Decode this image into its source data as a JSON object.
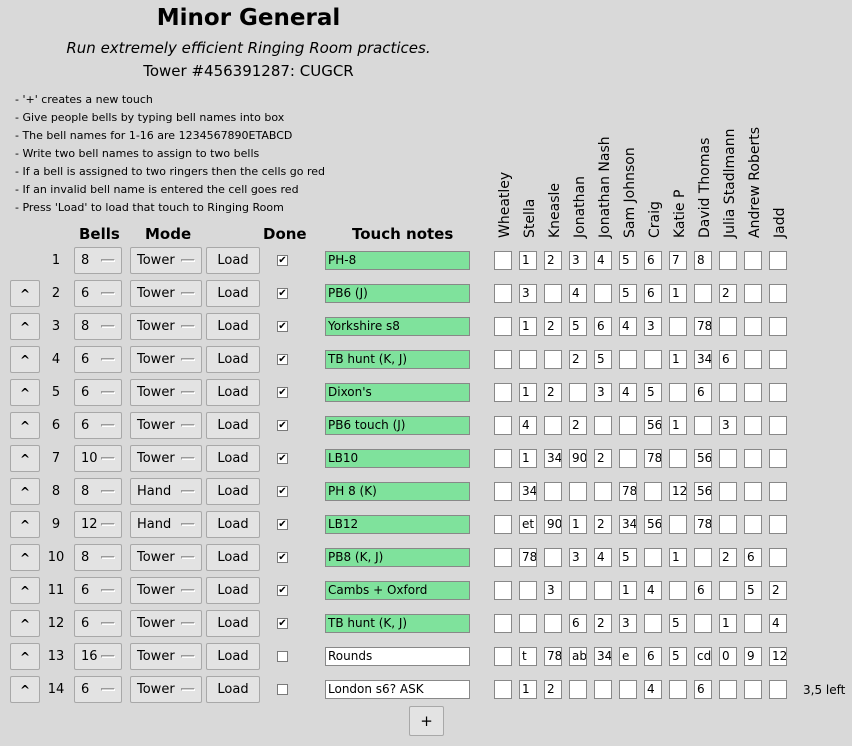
{
  "header": {
    "title": "Minor General",
    "subtitle": "Run extremely efficient Ringing Room practices.",
    "tower": "Tower #456391287: CUGCR"
  },
  "instructions": [
    "- '+' creates a new touch",
    "- Give people bells by typing bell names into box",
    "- The bell names for 1-16 are 1234567890ETABCD",
    "- Write two bell names to assign to two bells",
    "- If a bell is assigned to two ringers then the cells go red",
    "- If an invalid bell name is entered the cell goes red",
    "- Press 'Load' to load that touch to Ringing Room"
  ],
  "columns": {
    "bells": "Bells",
    "mode": "Mode",
    "done": "Done",
    "notes": "Touch notes"
  },
  "ringers": [
    "Wheatley",
    "Stella",
    "Kneasle",
    "Jonathan",
    "Jonathan Nash",
    "Sam Johnson",
    "Craig",
    "Katie P",
    "David Thomas",
    "Julia Stadlmann",
    "Andrew Roberts",
    "Jadd"
  ],
  "move_up_label": "^",
  "load_label": "Load",
  "add_button_label": "+",
  "touches": [
    {
      "num": "1",
      "bells": "8",
      "mode": "Tower",
      "done": true,
      "notes": "PH-8",
      "assign": [
        "",
        "1",
        "2",
        "3",
        "4",
        "5",
        "6",
        "7",
        "8",
        "",
        "",
        ""
      ],
      "extra": ""
    },
    {
      "num": "2",
      "bells": "6",
      "mode": "Tower",
      "done": true,
      "notes": "PB6 (J)",
      "assign": [
        "",
        "3",
        "",
        "4",
        "",
        "5",
        "6",
        "1",
        "",
        "2",
        "",
        ""
      ],
      "extra": ""
    },
    {
      "num": "3",
      "bells": "8",
      "mode": "Tower",
      "done": true,
      "notes": "Yorkshire s8",
      "assign": [
        "",
        "1",
        "2",
        "5",
        "6",
        "4",
        "3",
        "",
        "78",
        "",
        "",
        ""
      ],
      "extra": ""
    },
    {
      "num": "4",
      "bells": "6",
      "mode": "Tower",
      "done": true,
      "notes": "TB hunt (K, J)",
      "assign": [
        "",
        "",
        "",
        "2",
        "5",
        "",
        "",
        "1",
        "34",
        "6",
        "",
        ""
      ],
      "extra": ""
    },
    {
      "num": "5",
      "bells": "6",
      "mode": "Tower",
      "done": true,
      "notes": "Dixon's",
      "assign": [
        "",
        "1",
        "2",
        "",
        "3",
        "4",
        "5",
        "",
        "6",
        "",
        "",
        ""
      ],
      "extra": ""
    },
    {
      "num": "6",
      "bells": "6",
      "mode": "Tower",
      "done": true,
      "notes": "PB6 touch (J)",
      "assign": [
        "",
        "4",
        "",
        "2",
        "",
        "",
        "56",
        "1",
        "",
        "3",
        "",
        ""
      ],
      "extra": ""
    },
    {
      "num": "7",
      "bells": "10",
      "mode": "Tower",
      "done": true,
      "notes": "LB10",
      "assign": [
        "",
        "1",
        "34",
        "90",
        "2",
        "",
        "78",
        "",
        "56",
        "",
        "",
        ""
      ],
      "extra": ""
    },
    {
      "num": "8",
      "bells": "8",
      "mode": "Hand",
      "done": true,
      "notes": "PH 8 (K)",
      "assign": [
        "",
        "34",
        "",
        "",
        "",
        "78",
        "",
        "12",
        "56",
        "",
        "",
        ""
      ],
      "extra": ""
    },
    {
      "num": "9",
      "bells": "12",
      "mode": "Hand",
      "done": true,
      "notes": "LB12",
      "assign": [
        "",
        "et",
        "90",
        "1",
        "2",
        "34",
        "56",
        "",
        "78",
        "",
        "",
        ""
      ],
      "extra": ""
    },
    {
      "num": "10",
      "bells": "8",
      "mode": "Tower",
      "done": true,
      "notes": "PB8 (K, J)",
      "assign": [
        "",
        "78",
        "",
        "3",
        "4",
        "5",
        "",
        "1",
        "",
        "2",
        "6",
        ""
      ],
      "extra": ""
    },
    {
      "num": "11",
      "bells": "6",
      "mode": "Tower",
      "done": true,
      "notes": "Cambs + Oxford",
      "assign": [
        "",
        "",
        "3",
        "",
        "",
        "1",
        "4",
        "",
        "6",
        "",
        "5",
        "2"
      ],
      "extra": ""
    },
    {
      "num": "12",
      "bells": "6",
      "mode": "Tower",
      "done": true,
      "notes": "TB hunt (K, J)",
      "assign": [
        "",
        "",
        "",
        "6",
        "2",
        "3",
        "",
        "5",
        "",
        "1",
        "",
        "4"
      ],
      "extra": ""
    },
    {
      "num": "13",
      "bells": "16",
      "mode": "Tower",
      "done": false,
      "notes": "Rounds",
      "assign": [
        "",
        "t",
        "78",
        "ab",
        "34",
        "e",
        "6",
        "5",
        "cd",
        "0",
        "9",
        "12"
      ],
      "extra": ""
    },
    {
      "num": "14",
      "bells": "6",
      "mode": "Tower",
      "done": false,
      "notes": "London s6? ASK",
      "assign": [
        "",
        "1",
        "2",
        "",
        "",
        "",
        "4",
        "",
        "6",
        "",
        "",
        ""
      ],
      "extra": "3,5 left"
    }
  ]
}
